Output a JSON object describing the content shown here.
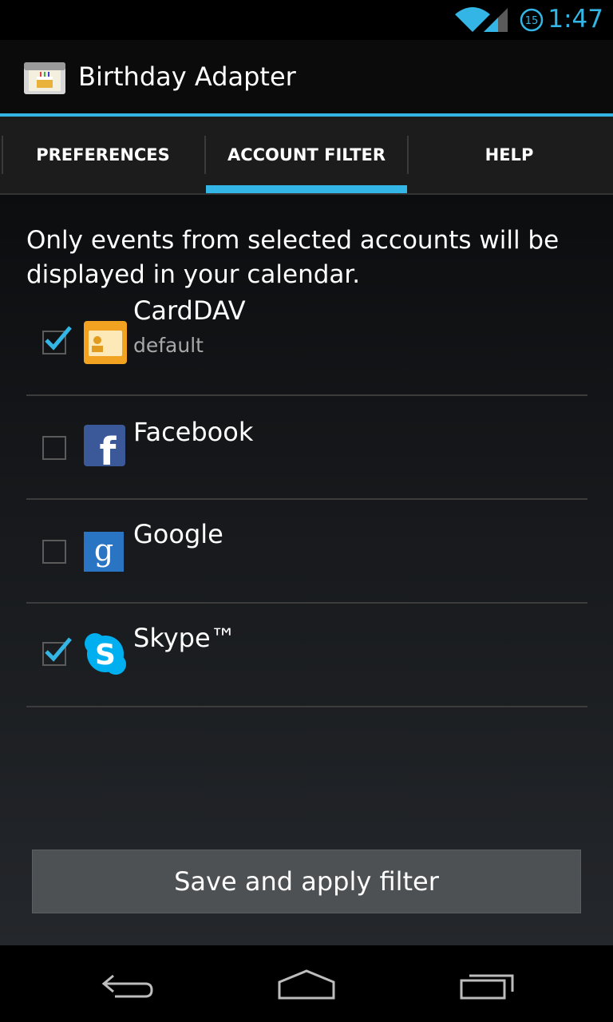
{
  "status_bar": {
    "time": "1:47",
    "sync_badge": "15",
    "icons": [
      "wifi-icon",
      "signal-icon",
      "sync-icon"
    ]
  },
  "app": {
    "title": "Birthday Adapter",
    "icon": "birthday-cake-icon"
  },
  "tabs": [
    {
      "label": "PREFERENCES",
      "selected": false
    },
    {
      "label": "ACCOUNT FILTER",
      "selected": true
    },
    {
      "label": "HELP",
      "selected": false
    }
  ],
  "intro_text": "Only events from selected accounts will be displayed in your calendar.",
  "accounts": [
    {
      "name": "CardDAV",
      "subtitle": "default",
      "checked": true,
      "icon": "carddav-icon"
    },
    {
      "name": "Facebook",
      "subtitle": "",
      "checked": false,
      "icon": "facebook-icon"
    },
    {
      "name": "Google",
      "subtitle": "",
      "checked": false,
      "icon": "google-icon"
    },
    {
      "name": "Skype™",
      "subtitle": "",
      "checked": true,
      "icon": "skype-icon"
    }
  ],
  "save_button_label": "Save and apply filter",
  "nav_bar": [
    "back-icon",
    "home-icon",
    "recents-icon"
  ],
  "colors": {
    "accent": "#33b5e5",
    "background": "#000000"
  }
}
